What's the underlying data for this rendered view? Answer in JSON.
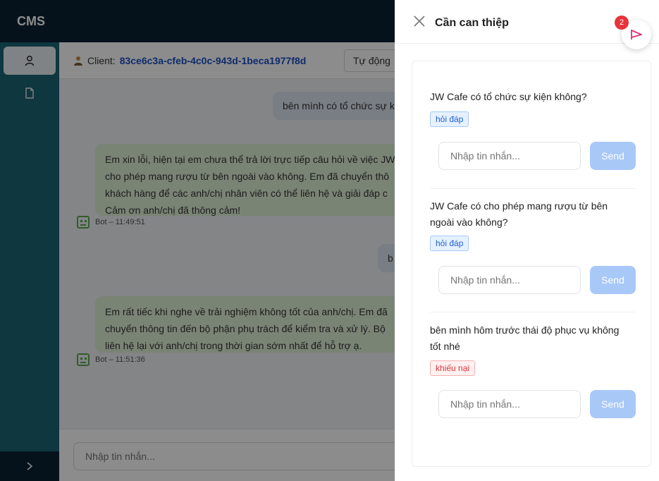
{
  "app": {
    "logo": "CMS"
  },
  "sidebar": {
    "items": [
      {
        "icon": "user-icon"
      },
      {
        "icon": "file-icon"
      }
    ],
    "expand_icon": "chevron-right-icon"
  },
  "client": {
    "label": "Client:",
    "id": "83ce6c3a-cfeb-4c0c-943d-1beca1977f8d"
  },
  "mode": {
    "label": "Tự động"
  },
  "chat": {
    "messages": [
      {
        "role": "user",
        "text": "bên mình có tổ chức sự k"
      },
      {
        "role": "bot",
        "lines": [
          "Em xin lỗi, hiện tại em chưa thể trả lời trực tiếp câu hỏi về việc JW",
          "cho phép mang rượu từ bên ngoài vào không. Em đã chuyển thô",
          "khách hàng để các anh/chị nhân viên có thể liên hệ và giải đáp c",
          "Cảm ơn anh/chị đã thông cảm!"
        ],
        "meta": "Bot – 11:49:51"
      },
      {
        "role": "user",
        "text": "b"
      },
      {
        "role": "bot",
        "lines": [
          "Em rất tiếc khi nghe về trải nghiệm không tốt của anh/chị. Em đã",
          "chuyển thông tin đến bộ phận phụ trách để kiểm tra và xử lý. Bộ",
          "liên hệ lại với anh/chị trong thời gian sớm nhất để hỗ trợ ạ."
        ],
        "meta": "Bot – 11:51:36"
      }
    ],
    "composer_placeholder": "Nhập tin nhắn..."
  },
  "drawer": {
    "title": "Cần can thiệp",
    "badge_count": "2",
    "items": [
      {
        "question": "JW Cafe có tổ chức sự kiện không?",
        "tag": "hỏi đáp",
        "tag_type": "info",
        "input_placeholder": "Nhập tin nhắn...",
        "send_label": "Send"
      },
      {
        "question": "JW Cafe có cho phép mang rượu từ bên ngoài vào không?",
        "tag": "hỏi đáp",
        "tag_type": "info",
        "input_placeholder": "Nhập tin nhắn...",
        "send_label": "Send"
      },
      {
        "question": "bên mình hôm trước thái độ phục vụ không tốt nhé",
        "tag": "khiếu nại",
        "tag_type": "danger",
        "input_placeholder": "Nhập tin nhắn...",
        "send_label": "Send"
      }
    ]
  },
  "colors": {
    "topbar": "#0a2233",
    "sidebar": "#1b6574",
    "accent": "#1d4fc4",
    "send": "#a8c8f8",
    "badge": "#e5343a",
    "flag": "#e0307a"
  }
}
